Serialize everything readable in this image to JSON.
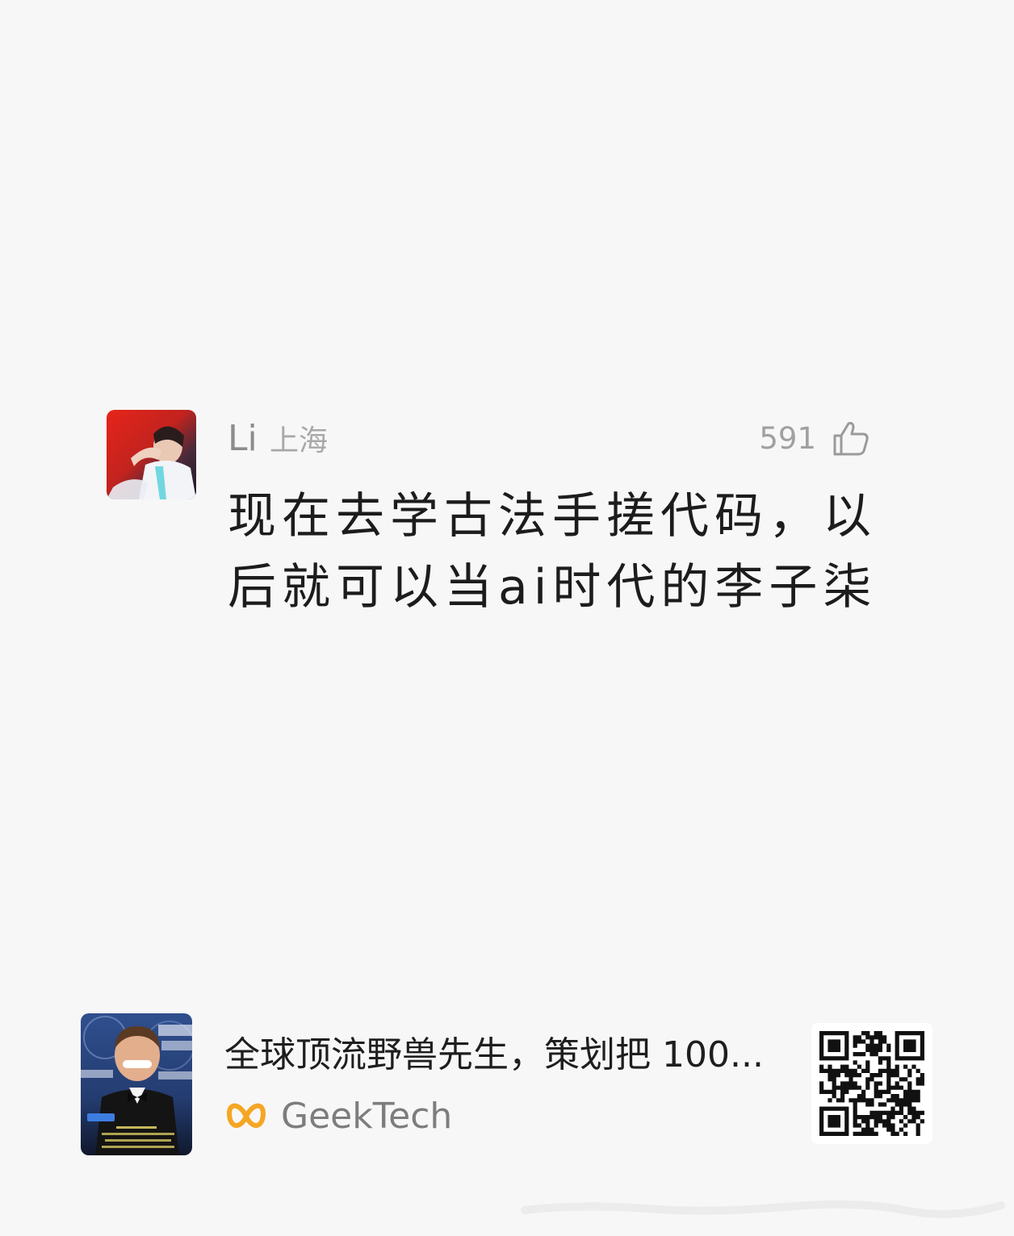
{
  "comment": {
    "avatar_icon": "user-avatar-photo",
    "user_name": "Li",
    "location": "上海",
    "like_count": "591",
    "like_icon": "thumbs-up-icon",
    "text": "现在去学古法手搓代码，以后就可以当ai时代的李子柒"
  },
  "share": {
    "thumbnail_icon": "article-thumbnail",
    "thumbnail_badge": "GeekTech",
    "title": "全球顶流野兽先生，策划把 100...",
    "source_icon": "geektech-logo",
    "source_name": "GeekTech",
    "qr_icon": "qr-code-icon"
  },
  "colors": {
    "background": "#f7f7f7",
    "text_primary": "#1c1c1c",
    "text_secondary": "#8c8c8c",
    "brand_orange": "#f5a623"
  }
}
